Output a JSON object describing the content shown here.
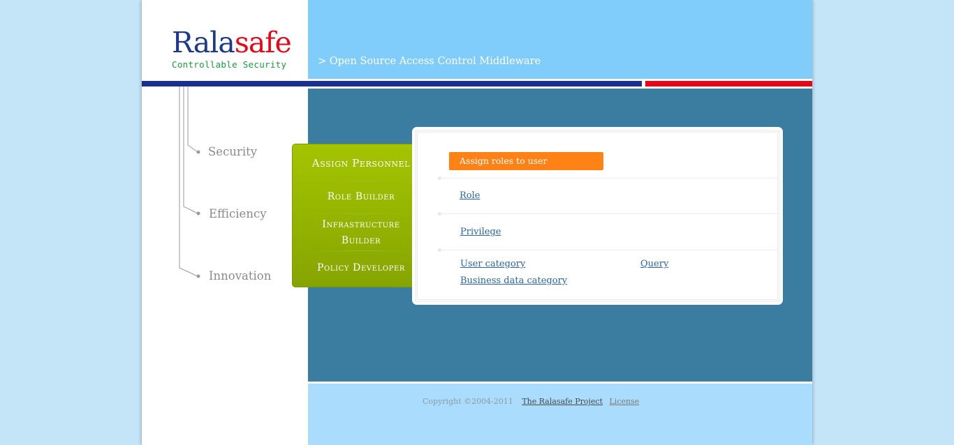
{
  "header": {
    "logo_part1": "Rala",
    "logo_part2": "safe",
    "tagline": "Controllable Security",
    "banner_text": "> Open Source Access Control Middleware"
  },
  "left_nav": {
    "items": [
      {
        "label": "Security"
      },
      {
        "label": "Efficiency"
      },
      {
        "label": "Innovation"
      }
    ]
  },
  "green_menu": {
    "items": [
      {
        "label": "Assign Personnel"
      },
      {
        "label": "Role Builder"
      },
      {
        "label": "Infrastructure Builder"
      },
      {
        "label": "Policy Developer"
      }
    ]
  },
  "card": {
    "header_button": "Assign roles to user",
    "links": {
      "role": "Role",
      "privilege": "Privilege",
      "user_category": "User category",
      "query": "Query",
      "business_data_category": "Business data category"
    }
  },
  "footer": {
    "copyright": "Copyright ©2004-2011",
    "project_link": "The Ralasafe Project",
    "license_link": "License"
  },
  "colors": {
    "brand_blue": "#1b3a8e",
    "brand_red": "#e20a1a",
    "tagline_green": "#1a9a3c",
    "banner_blue": "#80ccfb",
    "content_blue": "#3a7da0",
    "menu_green": "#a4c400",
    "accent_orange": "#ff8217"
  }
}
